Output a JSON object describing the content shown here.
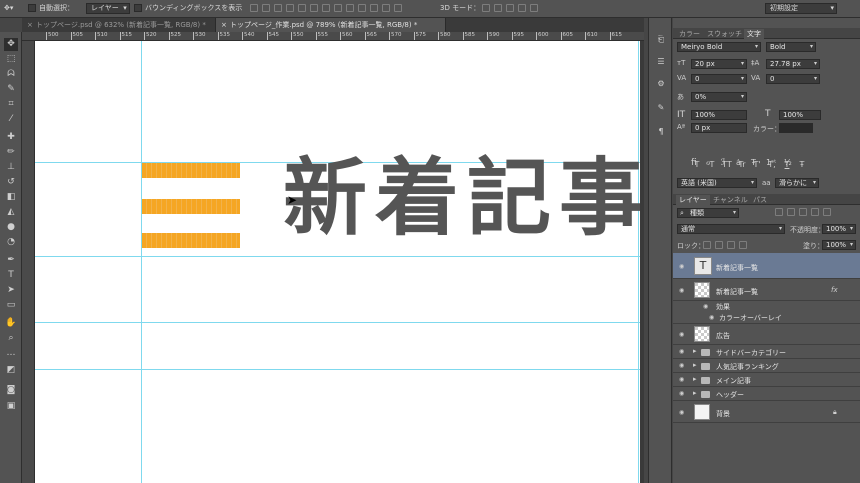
{
  "options_bar": {
    "auto_select_label": "自動選択：",
    "auto_select_value": "レイヤー",
    "bounding_box_label": "バウンディングボックスを表示",
    "mode_3d_label": "3D モード：",
    "workspace": "初期設定"
  },
  "doc_tabs": [
    {
      "label": "トップページ.psd @ 632% (新着記事一覧, RGB/8) *",
      "active": false
    },
    {
      "label": "トップページ_作業.psd @ 789% (新着記事一覧, RGB/8) *",
      "active": true
    }
  ],
  "ruler_marks": [
    "500",
    "505",
    "510",
    "515",
    "520",
    "525",
    "530",
    "535",
    "540",
    "545",
    "550",
    "555",
    "560",
    "565",
    "570",
    "575",
    "580",
    "585",
    "590",
    "595",
    "600",
    "605",
    "610",
    "615"
  ],
  "canvas": {
    "headline": "新着記事",
    "bar_color": "#f5a623",
    "guide_color": "#7fd9ee"
  },
  "char_panel": {
    "tabs": [
      {
        "label": "カラー",
        "active": false
      },
      {
        "label": "スウォッチ",
        "active": false
      },
      {
        "label": "文字",
        "active": true
      }
    ],
    "font_family": "Meiryo Bold",
    "font_style": "Bold",
    "font_size": "20 px",
    "leading": "27.78 px",
    "kerning": "0",
    "tracking": "0",
    "tsume": "0%",
    "vscale": "100%",
    "hscale": "100%",
    "baseline": "0 px",
    "color_label": "カラー：",
    "style_buttons": [
      "T",
      "T",
      "TT",
      "Tr",
      "T'",
      "T,",
      "T",
      "Ŧ"
    ],
    "language": "英語 (米国)",
    "antialias_label": "aa",
    "antialias": "滑らかに"
  },
  "layers_panel": {
    "tabs": [
      {
        "label": "レイヤー",
        "active": true
      },
      {
        "label": "チャンネル",
        "active": false
      },
      {
        "label": "パス",
        "active": false
      }
    ],
    "filter_kind": "種類",
    "blend_mode": "通常",
    "opacity_label": "不透明度：",
    "opacity": "100%",
    "lock_label": "ロック：",
    "fill_label": "塗り：",
    "fill": "100%",
    "fx_label": "fx",
    "layers": [
      {
        "name": "新着記事一覧",
        "kind": "text",
        "selected": true
      },
      {
        "name": "新着記事一覧",
        "kind": "raster",
        "selected": false,
        "fx": true
      },
      {
        "name": "効果",
        "kind": "effect-group"
      },
      {
        "name": "カラーオーバーレイ",
        "kind": "effect"
      },
      {
        "name": "広告",
        "kind": "raster",
        "selected": false
      },
      {
        "name": "サイドバーカテゴリー",
        "kind": "folder"
      },
      {
        "name": "人気記事ランキング",
        "kind": "folder"
      },
      {
        "name": "メイン記事",
        "kind": "folder"
      },
      {
        "name": "ヘッダー",
        "kind": "folder"
      },
      {
        "name": "背景",
        "kind": "background"
      }
    ]
  }
}
